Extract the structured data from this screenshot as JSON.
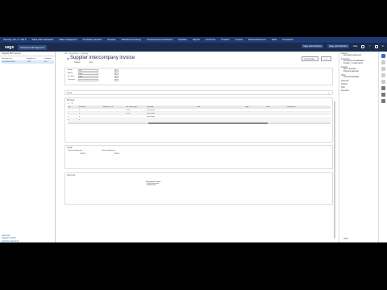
{
  "topnav": [
    "Sourcing, sort, cl - Self S",
    "Sales order transaction",
    "Sales management",
    "Purchasing transfers",
    "Receipts",
    "Statistical processing",
    "Invoice/request transactions",
    "Payables",
    "Reports",
    "Customers",
    "Products",
    "Invoices",
    "Bookmarked items",
    "Tasks",
    "Procedures"
  ],
  "header": {
    "logo": "sage",
    "app": "Enterprise Management",
    "links": [
      "Sage administration",
      "Sage administration"
    ],
    "help": "Help"
  },
  "left": {
    "title": "Supplier BP invoices",
    "cols": [
      "Document no.",
      "Supplier no.",
      "Category"
    ],
    "rows": [
      [
        "S1000000000011",
        "V100",
        "INV"
      ]
    ],
    "links": [
      "Last read",
      "Supplier invoices",
      "Customer payments"
    ]
  },
  "main": {
    "crumb": "AP - Accounting  >  Invoicing",
    "title": "Supplier intercompany invoice",
    "tabs": [
      "Header",
      "Lines"
    ],
    "btn_create": "New invoice",
    "btn_other": "Save",
    "header_fields": [
      {
        "l": "Entity",
        "v": "US",
        "v2": "5"
      },
      {
        "l": "Bill-by",
        "v": "Test",
        "v2": "5"
      },
      {
        "l": "Inv. date",
        "v": "USD",
        "v2": "5"
      },
      {
        "l": "Currency",
        "v": "",
        "v2": ""
      }
    ],
    "lines_label": "Lines",
    "grid_label": "BP lines",
    "grid_cols": [
      "Typ",
      "Account",
      "Amount - tax",
      "Tax level/Type",
      "Quantity",
      "",
      "Free",
      "Sign",
      "Total",
      "Dimension"
    ],
    "grid_rows": [
      [
        "1",
        "5",
        "",
        "10.00",
        "Free items",
        "",
        "",
        "",
        "",
        ""
      ],
      [
        "2",
        "5",
        "",
        "10.00",
        "Free items",
        "",
        "",
        "",
        "",
        ""
      ],
      [
        "3",
        "5",
        "",
        "",
        "Free items",
        "",
        "",
        "",
        "",
        ""
      ],
      [
        "4",
        "5",
        "",
        "",
        "",
        "",
        "",
        "",
        "",
        ""
      ]
    ],
    "totals_label": "Totals",
    "total_excl_label": "Total excluding tax",
    "total_excl": "200.00",
    "total_incl_label": "Total including tax",
    "total_incl": "200.00",
    "approval_label": "Approval",
    "approval_status_label": "BP approval status",
    "approval_opts": [
      "Not authorized",
      "Authorized"
    ]
  },
  "right": {
    "groups": [
      {
        "h": "Actions",
        "items": [
          "Accounting document"
        ]
      },
      {
        "h": "Functions",
        "items": [
          "Accounting consolidation",
          "Invoice >> credit memo"
        ]
      },
      {
        "h": "Reports",
        "items": [
          "Open questions",
          "Payment approval"
        ]
      },
      {
        "h": "Other",
        "items": [
          "Journal traceability"
        ]
      },
      {
        "h": "Selection",
        "items": []
      },
      {
        "h": "Options",
        "items": []
      },
      {
        "h": "Help",
        "items": []
      },
      {
        "h": "Favorites",
        "items": []
      }
    ],
    "bottom": "Close"
  }
}
